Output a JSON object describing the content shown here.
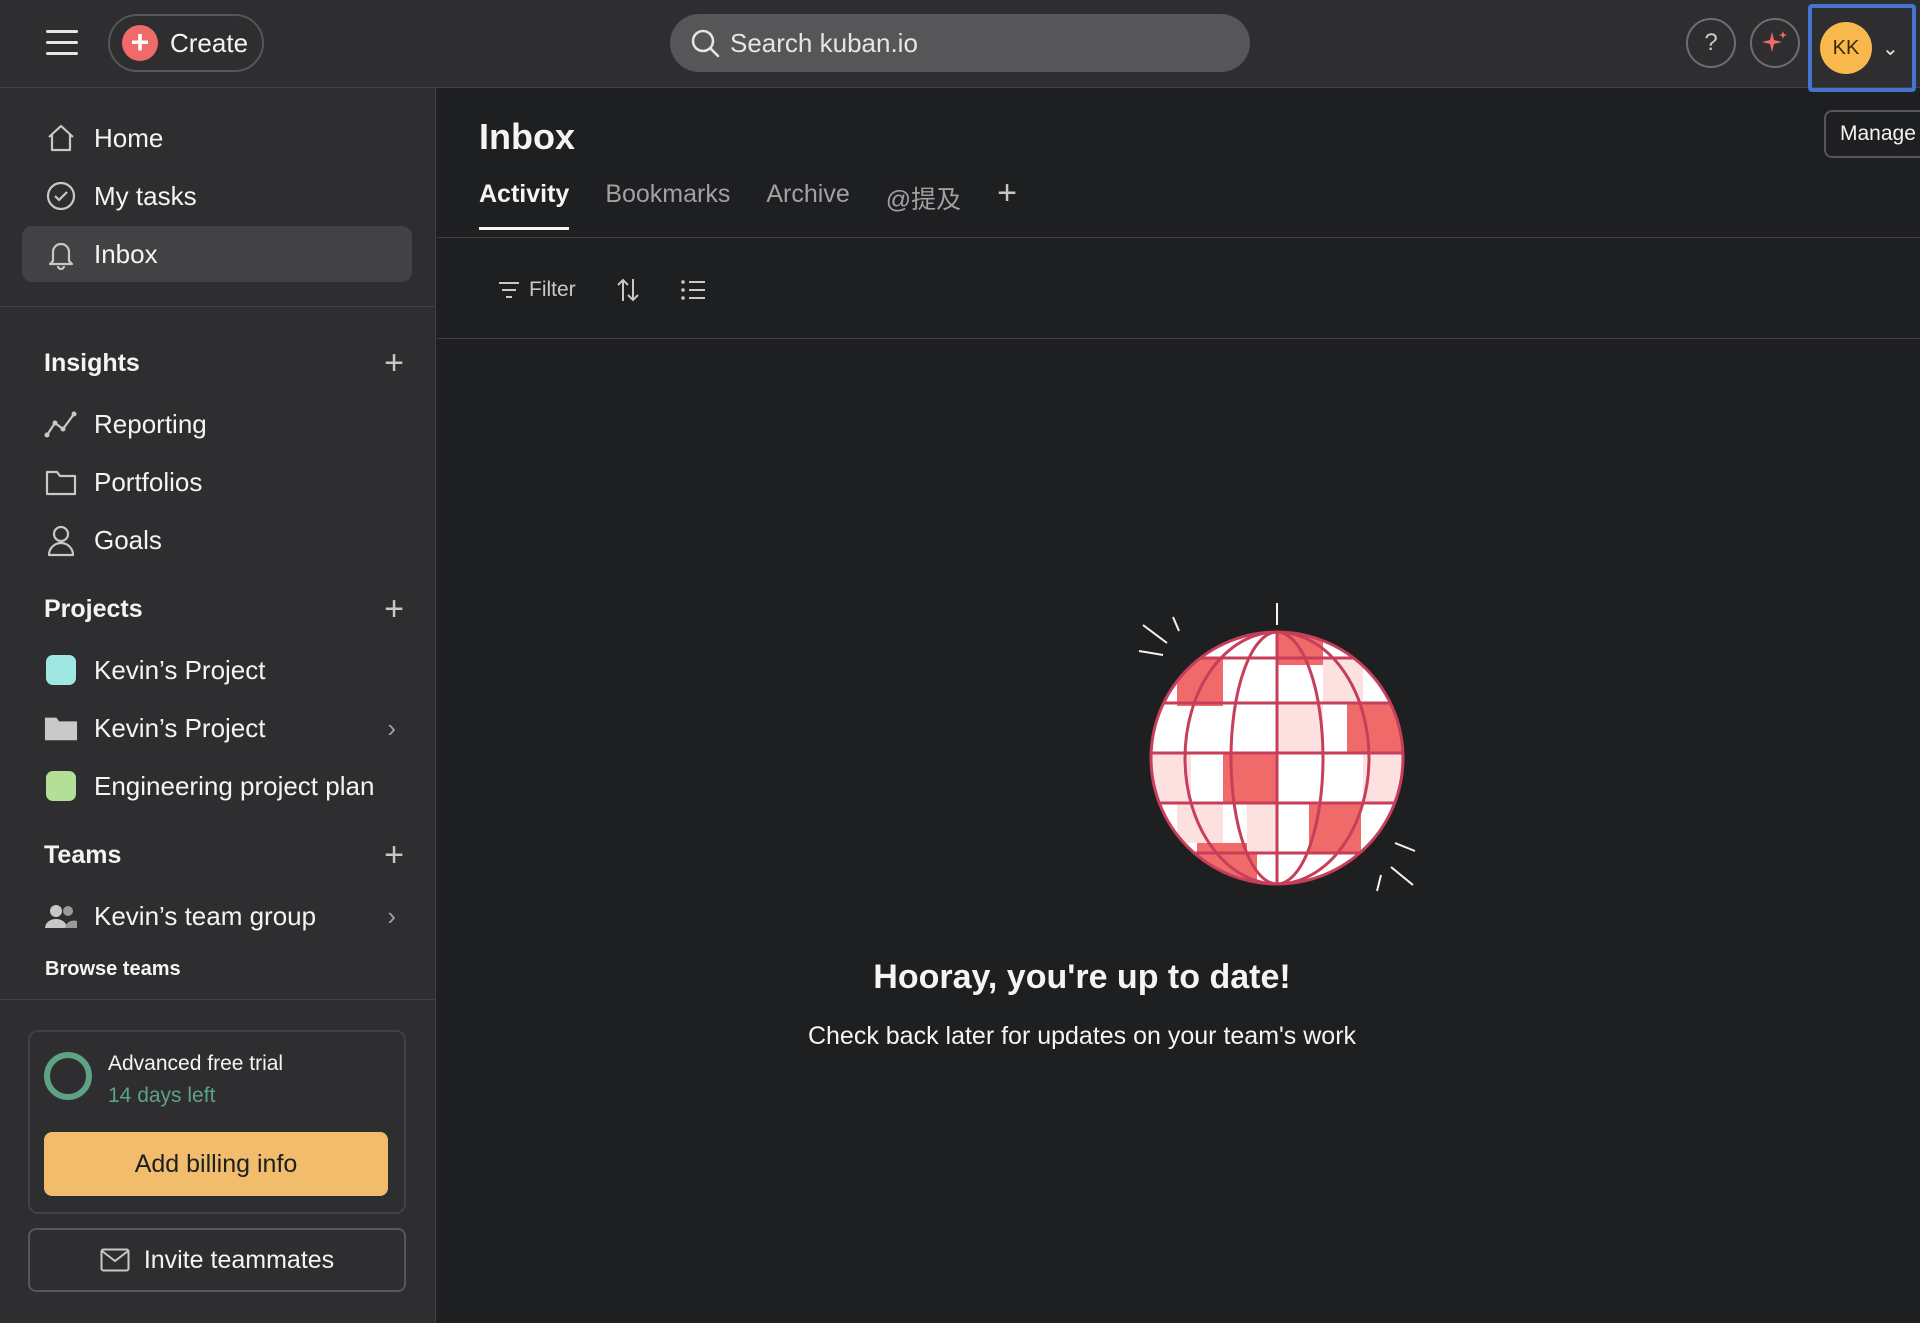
{
  "colors": {
    "background": "#1e1f21",
    "topbar": "#2e2e30",
    "accent_red": "#f06a6a",
    "trial_green": "#5da283",
    "billing_button": "#f1bd6c",
    "avatar": "#f8b84e",
    "focus_outline": "#4573d2"
  },
  "topbar": {
    "menu_icon": "hamburger-icon",
    "create_label": "Create",
    "search_placeholder": "Search kuban.io",
    "help_label": "?",
    "avatar_initials": "KK"
  },
  "sidebar": {
    "nav": [
      {
        "label": "Home",
        "icon": "home-icon"
      },
      {
        "label": "My tasks",
        "icon": "check-circle-icon"
      },
      {
        "label": "Inbox",
        "icon": "bell-icon",
        "active": true
      }
    ],
    "insights": {
      "title": "Insights",
      "items": [
        {
          "label": "Reporting",
          "icon": "chart-line-icon"
        },
        {
          "label": "Portfolios",
          "icon": "folder-icon"
        },
        {
          "label": "Goals",
          "icon": "person-icon"
        }
      ]
    },
    "projects": {
      "title": "Projects",
      "items": [
        {
          "label": "Kevin’s Project",
          "color": "#9ee7e3"
        },
        {
          "label": "Kevin’s Project",
          "color": "#c9c9c9"
        },
        {
          "label": "Engineering project plan",
          "color": "#b3df97"
        }
      ]
    },
    "teams": {
      "title": "Teams",
      "items": [
        {
          "label": "Kevin’s team group",
          "icon": "team-icon"
        }
      ],
      "browse_label": "Browse teams"
    },
    "trial": {
      "title": "Advanced free trial",
      "days_left": "14 days left",
      "billing_button": "Add billing info"
    },
    "invite_label": "Invite teammates"
  },
  "main": {
    "title": "Inbox",
    "manage_label": "Manage",
    "tabs": [
      {
        "label": "Activity",
        "active": true
      },
      {
        "label": "Bookmarks"
      },
      {
        "label": "Archive"
      },
      {
        "label": "@提及"
      }
    ],
    "toolbar": {
      "filter_label": "Filter",
      "sort_icon": "sort-icon",
      "view_icon": "list-icon"
    },
    "empty_state": {
      "title": "Hooray, you're up to date!",
      "subtitle": "Check back later for updates on your team's work"
    }
  }
}
